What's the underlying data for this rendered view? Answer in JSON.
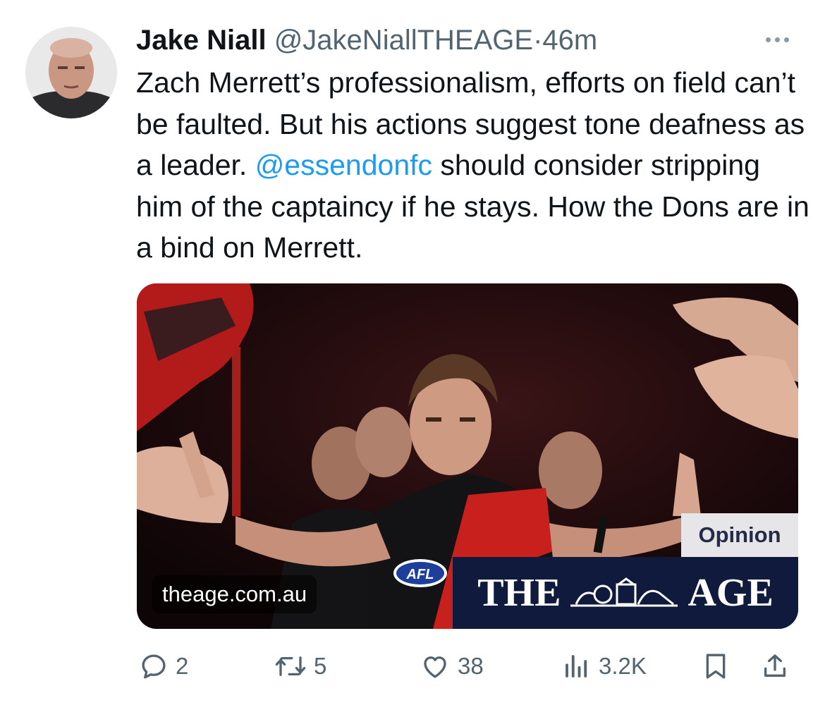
{
  "author": {
    "name": "Jake Niall",
    "handle": "@JakeNiallTHEAGE",
    "separator": "·",
    "time": "46m"
  },
  "tweet": {
    "text_part1": "Zach Merrett’s professionalism, efforts on field can’t be faulted. But his actions suggest tone deafness as a leader. ",
    "mention": "@essendonfc",
    "text_part2": " should consider stripping him of the captaincy if he stays. How the Dons are in a bind on Merrett."
  },
  "card": {
    "badge": "Opinion",
    "masthead_left": "THE",
    "masthead_right": "AGE",
    "domain": "theage.com.au",
    "logo_text": "AFL"
  },
  "actions": {
    "replies": "2",
    "retweets": "5",
    "likes": "38",
    "views": "3.2K"
  },
  "colors": {
    "text": "#0f1419",
    "secondary": "#536471",
    "link": "#1d9bf0",
    "masthead_bg": "#0f1a3d"
  },
  "icons": [
    "more-icon",
    "reply-icon",
    "retweet-icon",
    "like-icon",
    "views-icon",
    "bookmark-icon",
    "share-icon"
  ]
}
